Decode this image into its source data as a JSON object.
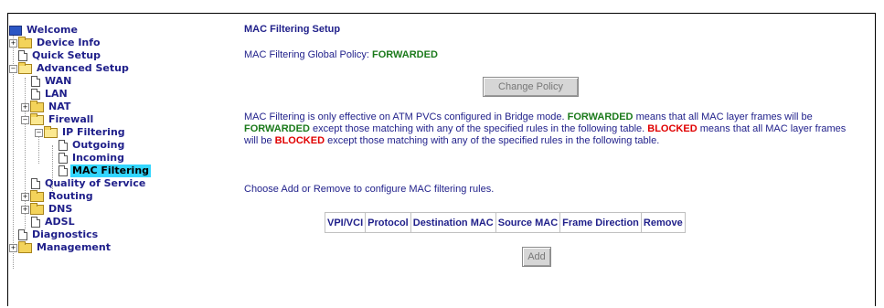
{
  "sidebar": {
    "items": [
      {
        "label": "Welcome"
      },
      {
        "label": "Device Info"
      },
      {
        "label": "Quick Setup"
      },
      {
        "label": "Advanced Setup"
      },
      {
        "label": "WAN"
      },
      {
        "label": "LAN"
      },
      {
        "label": "NAT"
      },
      {
        "label": "Firewall"
      },
      {
        "label": "IP Filtering"
      },
      {
        "label": "Outgoing"
      },
      {
        "label": "Incoming"
      },
      {
        "label": "MAC Filtering"
      },
      {
        "label": "Quality of Service"
      },
      {
        "label": "Routing"
      },
      {
        "label": "DNS"
      },
      {
        "label": "ADSL"
      },
      {
        "label": "Diagnostics"
      },
      {
        "label": "Management"
      }
    ]
  },
  "main": {
    "title": "MAC Filtering Setup",
    "policy_label": "MAC Filtering Global Policy: ",
    "policy_value": "FORWARDED",
    "change_button": "Change Policy",
    "desc": {
      "p1": "MAC Filtering is only effective on ATM PVCs configured in Bridge mode. ",
      "forwarded1": "FORWARDED",
      "p2": " means that all MAC layer frames will be ",
      "forwarded2": "FORWARDED",
      "p3": " except those matching with any of the specified rules in the following table. ",
      "blocked1": "BLOCKED",
      "p4": " means that all MAC layer frames will be ",
      "blocked2": "BLOCKED",
      "p5": " except those matching with any of the specified rules in the following table."
    },
    "choose_text": "Choose Add or Remove to configure MAC filtering rules.",
    "table_headers": [
      "VPI/VCI",
      "Protocol",
      "Destination MAC",
      "Source MAC",
      "Frame Direction",
      "Remove"
    ],
    "add_button": "Add"
  },
  "colors": {
    "text": "#1f1f8a",
    "forwarded": "#1b7a1b",
    "blocked": "#e00000",
    "selected_bg": "#33d6ff"
  }
}
